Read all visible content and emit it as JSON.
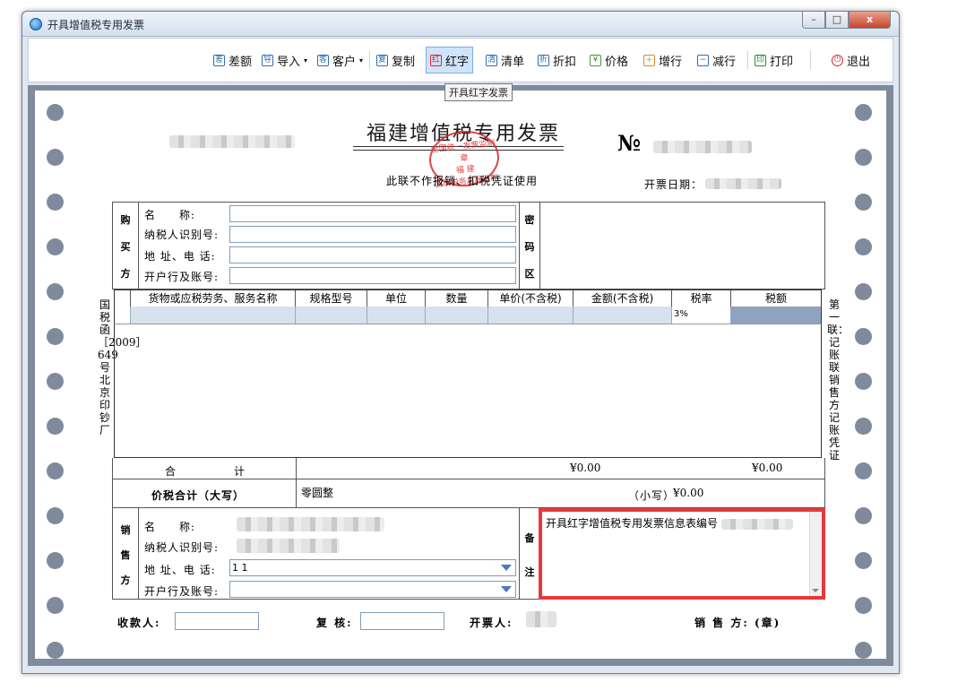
{
  "window": {
    "title": "开具增值税专用发票",
    "close_label": "x",
    "max_label": "□",
    "min_label": "–"
  },
  "toolbar": {
    "items": [
      {
        "label": "差额",
        "icon": "差"
      },
      {
        "label": "导入",
        "icon": "导",
        "caret": "▾"
      },
      {
        "label": "客户",
        "icon": "客",
        "caret": "▾"
      },
      {
        "label": "复制",
        "icon": "复"
      },
      {
        "label": "红字",
        "icon": "红"
      },
      {
        "label": "清单",
        "icon": "清"
      },
      {
        "label": "折扣",
        "icon": "折"
      },
      {
        "label": "价格",
        "icon": "¥"
      },
      {
        "label": "增行",
        "icon": "+"
      },
      {
        "label": "减行",
        "icon": "−"
      },
      {
        "label": "打印",
        "icon": "印"
      },
      {
        "label": "退出",
        "icon": "⏻"
      }
    ],
    "tooltip": "开具红字发票"
  },
  "invoice": {
    "title": "福建增值税专用发票",
    "seal_line1": "全国统一发票监制章",
    "seal_line2": "福  建",
    "seal_line3": "国家税务总局监制",
    "subtitle": "此联不作报销、扣税凭证使用",
    "no_mark": "№",
    "date_label": "开票日期：",
    "side_left": "国税函［2009］649号北京印钞厂",
    "side_right": "第一联：记账联 销售方记账凭证"
  },
  "buyer": {
    "section_label": [
      "购",
      "买",
      "方"
    ],
    "name_label": "名　　称:",
    "taxid_label": "纳税人识别号:",
    "address_label": "地 址、电 话:",
    "bank_label": "开户行及账号:",
    "cipher_label": [
      "密",
      "码",
      "区"
    ]
  },
  "items_table": {
    "headers": [
      "",
      "货物或应税劳务、服务名称",
      "规格型号",
      "单位",
      "数量",
      "单价(不含税)",
      "金额(不含税)",
      "税率",
      "税额"
    ],
    "row": [
      "",
      "",
      "",
      "",
      "",
      "",
      "",
      "3%",
      ""
    ]
  },
  "totals": {
    "label_he": "合",
    "label_ji": "计",
    "amount": "¥0.00",
    "tax": "¥0.00",
    "total_caps_label": "价税合计（大写）",
    "total_caps_value": "零圆整",
    "total_small_label": "（小写）",
    "total_small_value": "¥0.00"
  },
  "seller": {
    "section_label": [
      "销",
      "售",
      "方"
    ],
    "name_label": "名　　称:",
    "taxid_label": "纳税人识别号:",
    "address_label": "地 址、电 话:",
    "address_value": "1 1",
    "bank_label": "开户行及账号:",
    "remark_label": [
      "备",
      "注"
    ],
    "remark_text": "开具红字增值税专用发票信息表编号"
  },
  "signatures": {
    "payee_label": "收款人:",
    "reviewer_label": "复 核:",
    "issuer_label": "开票人:",
    "seller_label": "销 售 方: (章)"
  },
  "colors": {
    "highlight": "#e8383d",
    "seal": "#d7262a",
    "active_tab": "#cfe3fb"
  }
}
